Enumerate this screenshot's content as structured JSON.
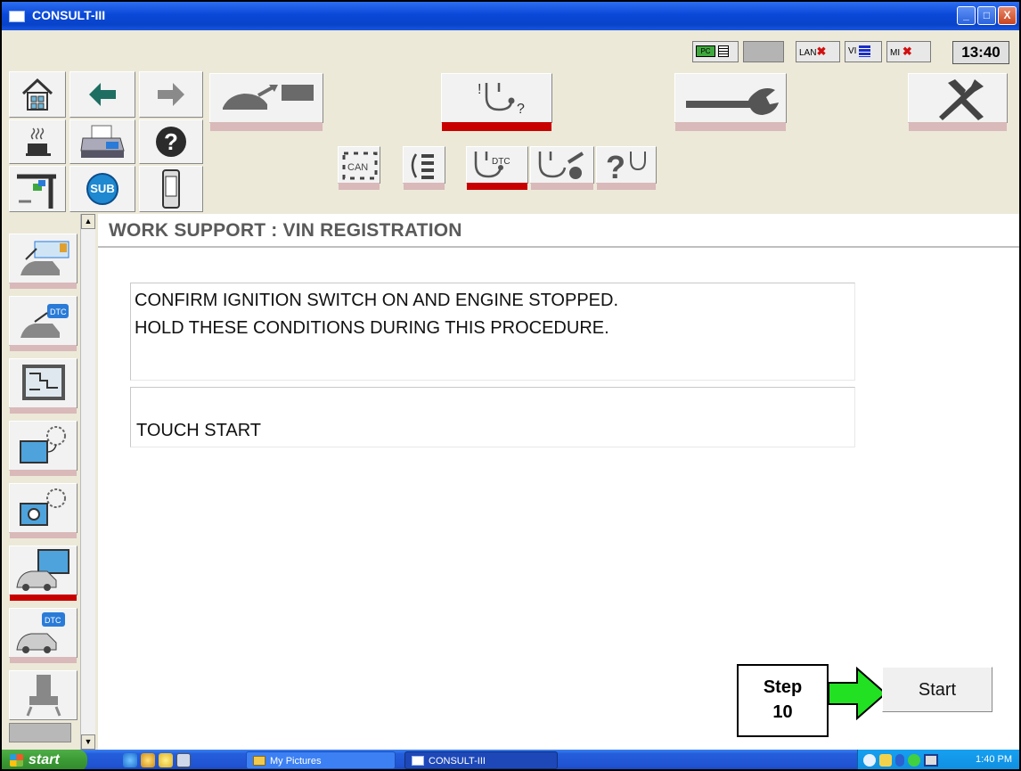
{
  "window": {
    "title": "CONSULT-III",
    "min_label": "_",
    "max_label": "□",
    "close_label": "X"
  },
  "status": {
    "pc_label": "PC",
    "lan_label": "LAN",
    "vi_label": "VI",
    "mi_label": "MI",
    "clock": "13:40"
  },
  "toolbar": {
    "sub_label": "SUB",
    "help_label": "?",
    "can_label": "CAN",
    "dtc_label": "DTC"
  },
  "sidebar": {
    "icons": [
      "ecu-registration-icon",
      "dtc-connector-icon",
      "monitor-panel-icon",
      "fan-monitor-icon",
      "fan-camera-icon",
      "vehicle-monitor-icon",
      "vehicle-dtc-icon",
      "seat-icon"
    ]
  },
  "page": {
    "title": "WORK SUPPORT : VIN REGISTRATION",
    "message_line1": "CONFIRM IGNITION SWITCH ON AND ENGINE STOPPED.",
    "message_line2": "HOLD THESE CONDITIONS DURING THIS PROCEDURE.",
    "instruction": "TOUCH START",
    "start_button": "Start"
  },
  "annotation": {
    "step_word": "Step",
    "step_number": "10",
    "arrow_color": "#22e022"
  },
  "taskbar": {
    "start_label": "start",
    "tasks": [
      {
        "label": "My Pictures"
      },
      {
        "label": "CONSULT-III"
      }
    ],
    "time": "1:40 PM"
  },
  "colors": {
    "accent_red": "#c80000",
    "title_blue": "#0a48d8",
    "app_bg": "#ece9d8"
  }
}
